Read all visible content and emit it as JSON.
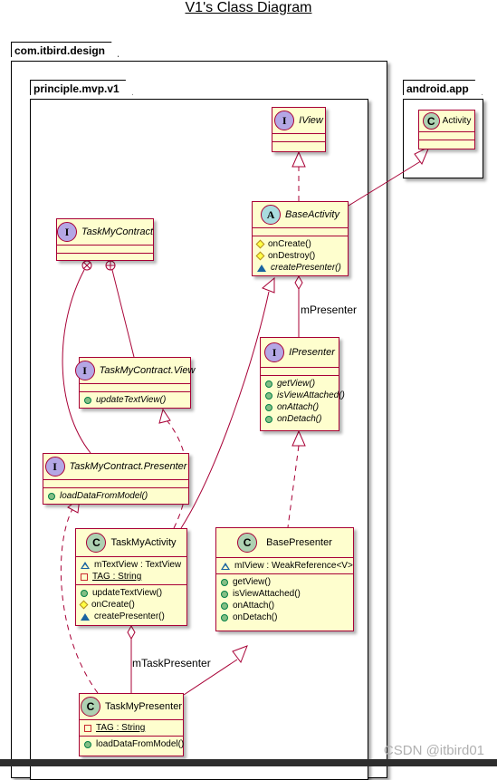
{
  "title": "V1's Class Diagram",
  "packages": {
    "outer": "com.itbird.design",
    "inner": "principle.mvp.v1",
    "android": "android.app"
  },
  "classes": {
    "iview": {
      "stereotype": "I",
      "name": "IView"
    },
    "activity": {
      "stereotype": "C",
      "name": "Activity"
    },
    "baseactivity": {
      "stereotype": "A",
      "name": "BaseActivity",
      "methods": [
        {
          "vis": "protected",
          "text": "onCreate()"
        },
        {
          "vis": "protected",
          "text": "onDestroy()"
        },
        {
          "vis": "package",
          "text": "createPresenter()"
        }
      ]
    },
    "taskmycontract": {
      "stereotype": "I",
      "name": "TaskMyContract"
    },
    "contractview": {
      "stereotype": "I",
      "name": "TaskMyContract.View",
      "methods": [
        {
          "vis": "public",
          "text": "updateTextView()"
        }
      ]
    },
    "ipresenter": {
      "stereotype": "I",
      "name": "IPresenter",
      "methods": [
        {
          "vis": "public",
          "text": "getView()"
        },
        {
          "vis": "public",
          "text": "isViewAttached()"
        },
        {
          "vis": "public",
          "text": "onAttach()"
        },
        {
          "vis": "public",
          "text": "onDetach()"
        }
      ]
    },
    "contractpresenter": {
      "stereotype": "I",
      "name": "TaskMyContract.Presenter",
      "methods": [
        {
          "vis": "public",
          "text": "loadDataFromModel()"
        }
      ]
    },
    "taskmyactivity": {
      "stereotype": "C",
      "name": "TaskMyActivity",
      "fields": [
        {
          "vis": "package",
          "text": "mTextView : TextView"
        },
        {
          "vis": "private",
          "text": "TAG : String",
          "static": true
        }
      ],
      "methods": [
        {
          "vis": "public",
          "text": "updateTextView()"
        },
        {
          "vis": "protected",
          "text": "onCreate()"
        },
        {
          "vis": "package",
          "text": "createPresenter()"
        }
      ]
    },
    "basepresenter": {
      "stereotype": "C",
      "name": "BasePresenter",
      "fields": [
        {
          "vis": "package",
          "text": "mIView : WeakReference<V>"
        }
      ],
      "methods": [
        {
          "vis": "public",
          "text": "getView()"
        },
        {
          "vis": "public",
          "text": "isViewAttached()"
        },
        {
          "vis": "public",
          "text": "onAttach()"
        },
        {
          "vis": "public",
          "text": "onDetach()"
        }
      ]
    },
    "taskmypresenter": {
      "stereotype": "C",
      "name": "TaskMyPresenter",
      "fields": [
        {
          "vis": "private",
          "text": "TAG : String",
          "static": true
        }
      ],
      "methods": [
        {
          "vis": "public",
          "text": "loadDataFromModel()"
        }
      ]
    }
  },
  "associations": {
    "mPresenter": "mPresenter",
    "mTaskPresenter": "mTaskPresenter"
  },
  "watermark": "CSDN @itbird01",
  "colors": {
    "border": "#a80036",
    "fill": "#fefece"
  }
}
